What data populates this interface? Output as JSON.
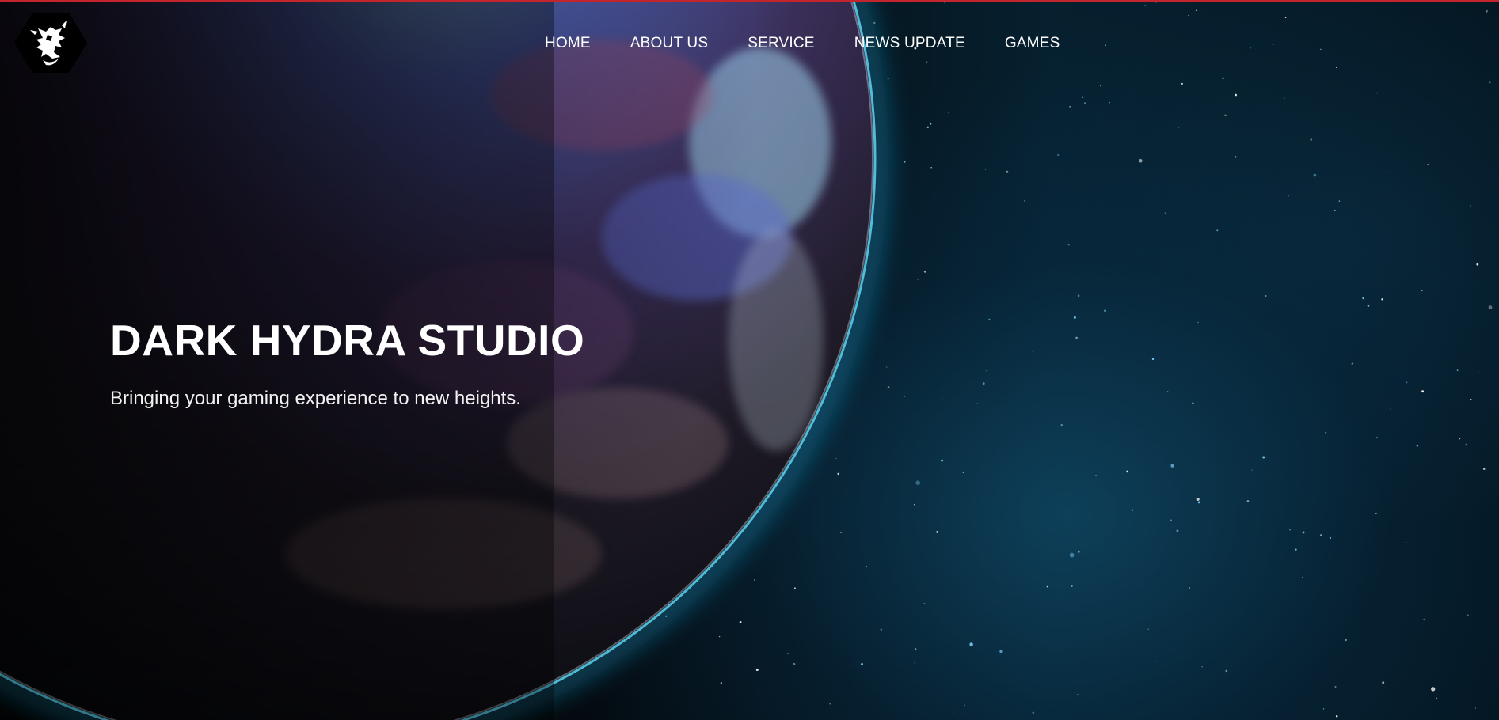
{
  "page": {
    "accent_color": "#c4242c",
    "background_color": "#03070b"
  },
  "header": {
    "logo_icon": "dragon-hexagon-logo",
    "nav": [
      {
        "label": "HOME"
      },
      {
        "label": "ABOUT US"
      },
      {
        "label": "SERVICE"
      },
      {
        "label": "NEWS UPDATE"
      },
      {
        "label": "GAMES"
      }
    ]
  },
  "hero": {
    "title": "DARK HYDRA STUDIO",
    "subtitle": "Bringing your gaming experience to new heights.",
    "background_image": "planet-in-space"
  }
}
